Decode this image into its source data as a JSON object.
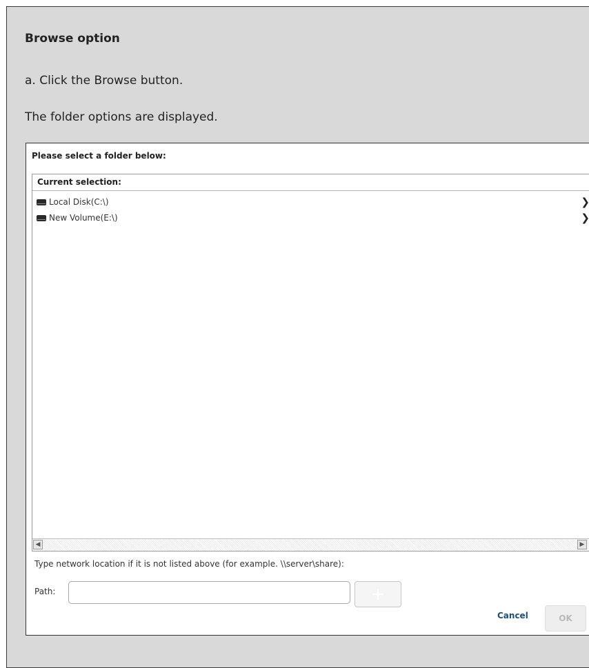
{
  "document": {
    "heading": "Browse option",
    "step": "a. Click the Browse button.",
    "description": "The folder options are displayed."
  },
  "dialog": {
    "title": "Please select a folder below:",
    "list": {
      "header": "Current selection:",
      "items": [
        {
          "label": "Local Disk(C:\\)",
          "icon": "drive-icon",
          "expand_icon": "chevron-right-icon"
        },
        {
          "label": "New Volume(E:\\)",
          "icon": "drive-icon",
          "expand_icon": "chevron-right-icon"
        }
      ]
    },
    "hint": "Type network location if it is not listed above (for example. \\\\server\\share):",
    "path_label": "Path:",
    "path_value": "",
    "add_icon": "plus-icon",
    "cancel_label": "Cancel",
    "ok_label": "OK"
  },
  "colors": {
    "page_background": "#d9d9d9",
    "cancel_link": "#1b4f80",
    "ok_disabled_text": "#b8b8b8"
  }
}
